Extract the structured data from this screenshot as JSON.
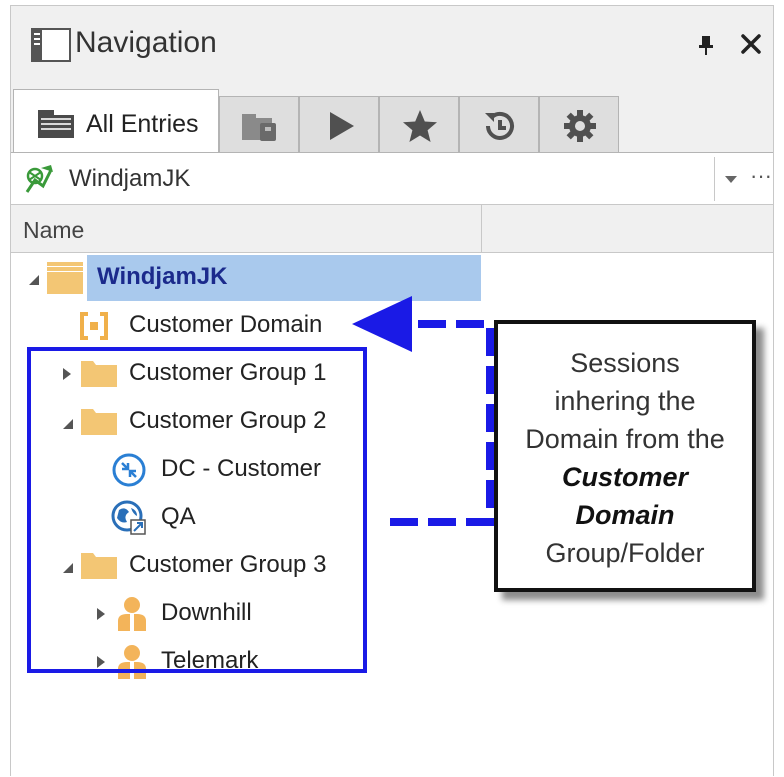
{
  "panel": {
    "title": "Navigation"
  },
  "tabs": [
    {
      "label": "All Entries",
      "icon": "all-entries-icon",
      "active": true
    },
    {
      "label": "",
      "icon": "vault-icon",
      "active": false
    },
    {
      "label": "",
      "icon": "play-icon",
      "active": false
    },
    {
      "label": "",
      "icon": "star-icon",
      "active": false
    },
    {
      "label": "",
      "icon": "history-icon",
      "active": false
    },
    {
      "label": "",
      "icon": "gear-icon",
      "active": false
    }
  ],
  "datasource": {
    "value": "WindjamJK",
    "more": "···"
  },
  "columns": {
    "name": "Name"
  },
  "tree": {
    "root": "WindjamJK",
    "domain": "Customer Domain",
    "group1": "Customer Group 1",
    "group2": "Customer Group 2",
    "dc": "DC - Customer",
    "qa": "QA",
    "group3": "Customer Group 3",
    "downhill": "Downhill",
    "telemark": "Telemark"
  },
  "callout": {
    "line1": "Sessions",
    "line2": "inhering the",
    "line3": "Domain from the",
    "line4": "Customer",
    "line5": "Domain",
    "line6": "Group/Folder"
  },
  "colors": {
    "selection": "#a9c9ed",
    "annotation_blue": "#1a1ae6",
    "folder": "#f3c674",
    "root_text": "#1b2a8c"
  }
}
